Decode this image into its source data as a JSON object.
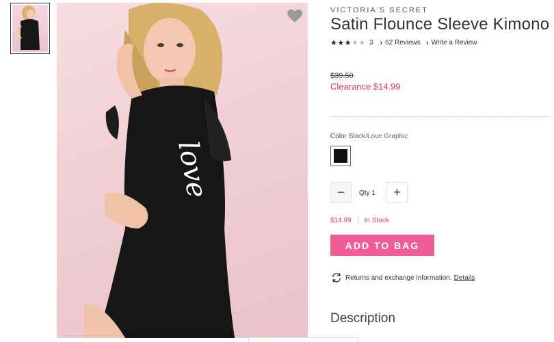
{
  "product": {
    "brand": "VICTORIA'S SECRET",
    "title": "Satin Flounce Sleeve Kimono",
    "rating": {
      "stars": 3,
      "max": 5,
      "count": "3"
    },
    "reviews_link": "62 Reviews",
    "write_review_link": "Write a Review",
    "original_price": "$39.50",
    "sale_price": "Clearance $14.99",
    "color": {
      "label": "Color",
      "value": "Black/Love Graphic",
      "swatch_color": "#111111"
    },
    "quantity": {
      "label": "Qty 1"
    },
    "stock": {
      "price": "$14.99",
      "status": "In Stock"
    },
    "add_to_bag": "ADD TO BAG",
    "returns": {
      "text": "Returns and exchange information.",
      "link": "Details"
    },
    "description_heading": "Description"
  },
  "image": {
    "graphic_text": "love"
  },
  "colors": {
    "accent": "#f05c95",
    "sale": "#e0336e",
    "heart": "#9a9a9a"
  },
  "icons": [
    "wishlist-heart-icon",
    "star-icon",
    "chevron-right-icon",
    "minus-icon",
    "plus-icon",
    "returns-icon"
  ]
}
